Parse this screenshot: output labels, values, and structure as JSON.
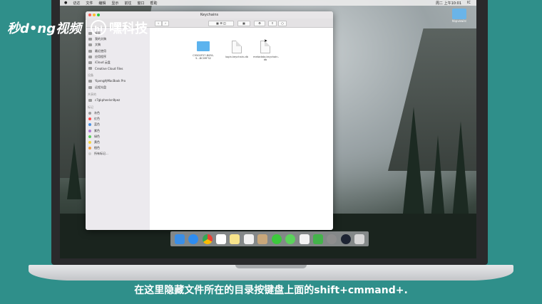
{
  "watermark": {
    "brand1": "秒d•ng视频",
    "hi": "hi",
    "brand2": "嘿科技"
  },
  "menubar": {
    "items": [
      "访达",
      "文件",
      "编辑",
      "显示",
      "前往",
      "窗口",
      "帮助"
    ],
    "clock": "周二 上午10:01",
    "user": "IC"
  },
  "desktop": {
    "folder_label": "hbpvowirc"
  },
  "finder": {
    "title": "Keychains",
    "sidebar": {
      "favorites": [
        "桌面",
        "我的文稿",
        "文稿",
        "最近使用",
        "应用程序",
        "iCloud 云盘",
        "Creative Cloud Files"
      ],
      "devices_head": "设备",
      "devices": [
        "Yipeng的MacBook Pro",
        "远程光盘"
      ],
      "shared_head": "共享的",
      "shared": [
        "c7gkpheelvn9pez"
      ],
      "tags_head": "标记",
      "tags": [
        {
          "label": "灰色",
          "color": "#9a9a9a"
        },
        {
          "label": "红色",
          "color": "#ff4b4b"
        },
        {
          "label": "蓝色",
          "color": "#4a90e2"
        },
        {
          "label": "紫色",
          "color": "#b07ad6"
        },
        {
          "label": "绿色",
          "color": "#5ccf5c"
        },
        {
          "label": "黄色",
          "color": "#f5d442"
        },
        {
          "label": "橙色",
          "color": "#f5a142"
        },
        {
          "label": "所有标记...",
          "color": "#cccccc"
        }
      ]
    },
    "files": [
      {
        "name": "C9500F57-B0FA-5...BC09F32",
        "kind": "folder"
      },
      {
        "name": "login.keychain-db",
        "kind": "doc"
      },
      {
        "name": "metadata.keychain-db",
        "kind": "doc"
      }
    ]
  },
  "dock": {
    "icons": [
      {
        "name": "finder-icon",
        "color": "#3a8ee6"
      },
      {
        "name": "safari-icon",
        "color": "#2d8cf0"
      },
      {
        "name": "chrome-icon",
        "color": "#e94335"
      },
      {
        "name": "calendar-icon",
        "color": "#ffffff"
      },
      {
        "name": "notes-icon",
        "color": "#f7e48b"
      },
      {
        "name": "pages-icon",
        "color": "#f1f1f1"
      },
      {
        "name": "contacts-icon",
        "color": "#c8a77a"
      },
      {
        "name": "wechat-icon",
        "color": "#3cc93c"
      },
      {
        "name": "messages-icon",
        "color": "#5bd35b"
      },
      {
        "name": "textedit-icon",
        "color": "#f3f3f3"
      },
      {
        "name": "numbers-icon",
        "color": "#43b34a"
      },
      {
        "name": "system-prefs-icon",
        "color": "#8e8e8e"
      },
      {
        "name": "quicktime-icon",
        "color": "#1d2433"
      },
      {
        "name": "trash-icon",
        "color": "#d7d7d7"
      }
    ]
  },
  "subtitle": "在这里隐藏文件所在的目录按键盘上面的shift+cmmand+."
}
